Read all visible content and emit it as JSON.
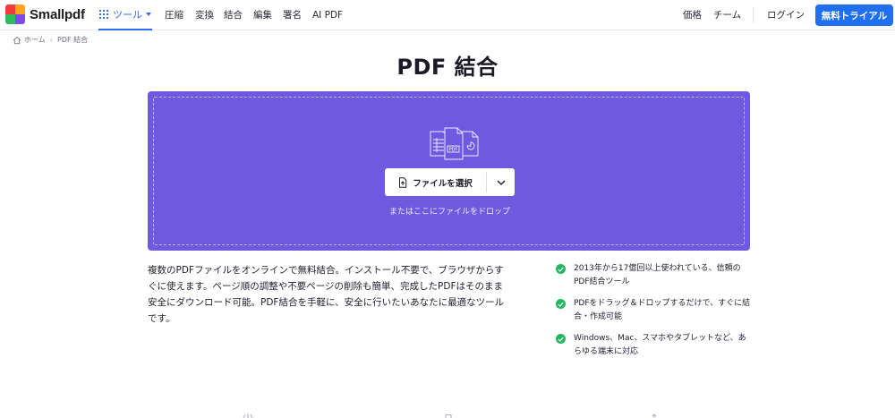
{
  "brand": {
    "name": "Smallpdf",
    "colors": [
      "#f23b3b",
      "#ffa41c",
      "#2dbb5e",
      "#7b4ce8"
    ]
  },
  "nav": {
    "tools_label": "ツール",
    "links": [
      "圧縮",
      "変換",
      "結合",
      "編集",
      "署名",
      "AI PDF"
    ],
    "right_links": [
      "価格",
      "チーム"
    ],
    "login_label": "ログイン",
    "trial_label": "無料トライアル",
    "accent_color": "#1f6ff0"
  },
  "breadcrumb": {
    "home": "ホーム",
    "current": "PDF 結合"
  },
  "page_title": "PDF 結合",
  "dropzone": {
    "background": "#6f5adf",
    "select_label": "ファイルを選択",
    "hint": "またはここにファイルをドロップ"
  },
  "description": "複数のPDFファイルをオンラインで無料結合。インストール不要で、ブラウザからすぐに使えます。ページ順の調整や不要ページの削除も簡単、完成したPDFはそのまま安全にダウンロード可能。PDF結合を手軽に、安全に行いたいあなたに最適なツールです。",
  "features": [
    "2013年から17億回以上使われている、信頼のPDF結合ツール",
    "PDFをドラッグ＆ドロップするだけで、すぐに結合・作成可能",
    "Windows、Mac、スマホやタブレットなど、あらゆる端末に対応"
  ],
  "icons": {
    "tools": "grid-icon",
    "home": "home-icon",
    "file": "file-icon",
    "dropdown": "chevron-down-icon",
    "feature": "check-circle-icon"
  }
}
